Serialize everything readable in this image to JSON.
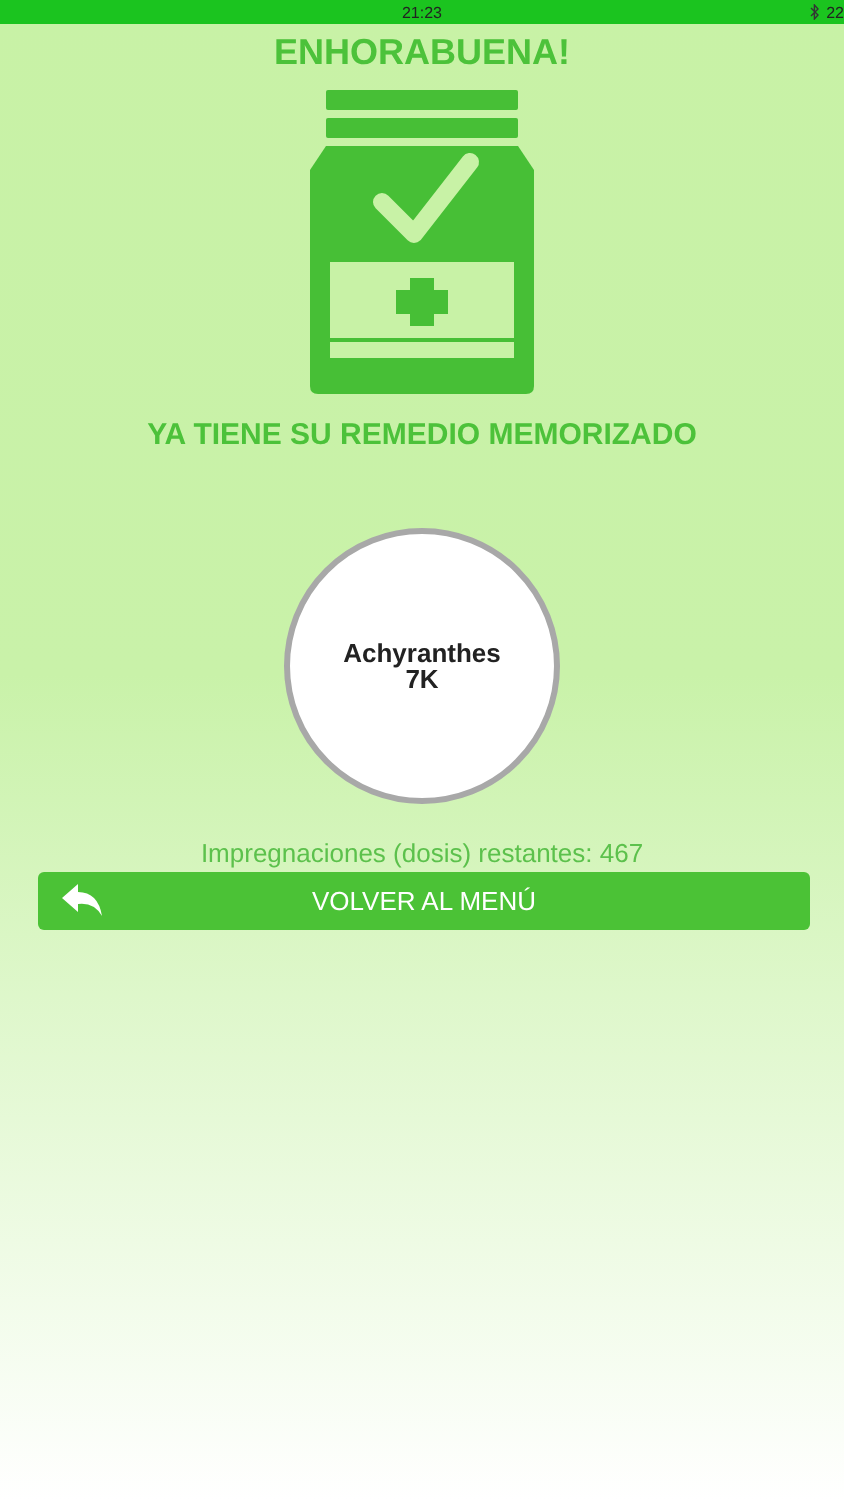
{
  "status_bar": {
    "time": "21:23",
    "battery": "22"
  },
  "title": "ENHORABUENA!",
  "subtitle": "YA TIENE SU REMEDIO MEMORIZADO",
  "remedy": {
    "name": "Achyranthes",
    "potency": "7K"
  },
  "remaining": "Impregnaciones (dosis) restantes: 467",
  "button": {
    "label": "VOLVER AL MENÚ"
  }
}
